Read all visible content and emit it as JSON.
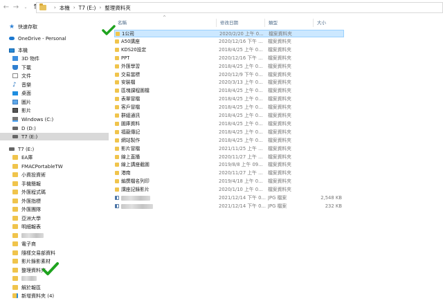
{
  "address": {
    "path": [
      "本機",
      "T7 (E:)",
      "整理資料夾"
    ]
  },
  "sidebar": {
    "items": [
      {
        "label": "快速存取",
        "icon": "star-icon"
      },
      {
        "label": "OneDrive - Personal",
        "icon": "cloud-icon"
      },
      {
        "label": "本機",
        "icon": "computer-icon"
      },
      {
        "label": "3D 物件",
        "icon": "cube-icon"
      },
      {
        "label": "下載",
        "icon": "download-icon"
      },
      {
        "label": "文件",
        "icon": "document-icon"
      },
      {
        "label": "音樂",
        "icon": "music-icon"
      },
      {
        "label": "桌面",
        "icon": "desktop-icon"
      },
      {
        "label": "圖片",
        "icon": "pictures-icon"
      },
      {
        "label": "影片",
        "icon": "video-icon"
      },
      {
        "label": "Windows (C:)",
        "icon": "windows-drive-icon"
      },
      {
        "label": "D (D:)",
        "icon": "drive-icon"
      },
      {
        "label": "T7 (E:)",
        "icon": "drive-icon"
      },
      {
        "label": "T7 (E:)",
        "icon": "drive-icon"
      },
      {
        "label": "EA庫",
        "icon": "folder-icon"
      },
      {
        "label": "FMACPortableTW",
        "icon": "folder-icon"
      },
      {
        "label": "小資投資術",
        "icon": "folder-icon"
      },
      {
        "label": "手機簡報",
        "icon": "folder-icon"
      },
      {
        "label": "外匯程式碼",
        "icon": "folder-icon"
      },
      {
        "label": "外匯指標",
        "icon": "folder-icon"
      },
      {
        "label": "外匯團隊",
        "icon": "folder-icon"
      },
      {
        "label": "亞洲大學",
        "icon": "folder-icon"
      },
      {
        "label": "明細報表",
        "icon": "folder-icon"
      },
      {
        "label": "",
        "icon": "folder-icon"
      },
      {
        "label": "電子商",
        "icon": "folder-icon"
      },
      {
        "label": "隨樣交易部資料",
        "icon": "folder-icon"
      },
      {
        "label": "影片錄影素材",
        "icon": "folder-icon"
      },
      {
        "label": "整理資料夾",
        "icon": "folder-icon"
      },
      {
        "label": "",
        "icon": "folder-icon"
      },
      {
        "label": "解於報區",
        "icon": "folder-icon"
      },
      {
        "label": "新增資料夾 (4)",
        "icon": "new-folder-icon"
      }
    ]
  },
  "columns": {
    "name": "名稱",
    "date": "修改日期",
    "type": "類型",
    "size": "大小"
  },
  "files": [
    {
      "name": "1公司",
      "date": "2020/2/20 上午 0...",
      "type": "檔案資料夾",
      "size": "",
      "kind": "folder"
    },
    {
      "name": "A50講座",
      "date": "2020/12/16 下午 ...",
      "type": "檔案資料夾",
      "size": "",
      "kind": "folder"
    },
    {
      "name": "KDS20設定",
      "date": "2018/4/25 上午 0...",
      "type": "檔案資料夾",
      "size": "",
      "kind": "folder"
    },
    {
      "name": "PPT",
      "date": "2020/12/16 下午 ...",
      "type": "檔案資料夾",
      "size": "",
      "kind": "folder"
    },
    {
      "name": "外匯學習",
      "date": "2018/4/25 上午 0...",
      "type": "檔案資料夾",
      "size": "",
      "kind": "folder"
    },
    {
      "name": "交易當標",
      "date": "2020/12/9 下午 0...",
      "type": "檔案資料夾",
      "size": "",
      "kind": "folder"
    },
    {
      "name": "安裝檔",
      "date": "2020/3/13 上午 0...",
      "type": "檔案資料夾",
      "size": "",
      "kind": "folder"
    },
    {
      "name": "區塊課程圖檔",
      "date": "2018/4/25 上午 0...",
      "type": "檔案資料夾",
      "size": "",
      "kind": "folder"
    },
    {
      "name": "表單冒檔",
      "date": "2018/4/25 上午 0...",
      "type": "檔案資料夾",
      "size": "",
      "kind": "folder"
    },
    {
      "name": "客戶冒檔",
      "date": "2018/4/25 上午 0...",
      "type": "檔案資料夾",
      "size": "",
      "kind": "folder"
    },
    {
      "name": "群組通訊",
      "date": "2018/4/25 上午 0...",
      "type": "檔案資料夾",
      "size": "",
      "kind": "folder"
    },
    {
      "name": "圖庫資料",
      "date": "2018/4/25 上午 0...",
      "type": "檔案資料夾",
      "size": "",
      "kind": "folder"
    },
    {
      "name": "福龍傳記",
      "date": "2018/4/25 上午 0...",
      "type": "檔案資料夾",
      "size": "",
      "kind": "folder"
    },
    {
      "name": "網站製作",
      "date": "2018/4/25 上午 0...",
      "type": "檔案資料夾",
      "size": "",
      "kind": "folder"
    },
    {
      "name": "影片冒檔",
      "date": "2021/11/25 上午 ...",
      "type": "檔案資料夾",
      "size": "",
      "kind": "folder"
    },
    {
      "name": "線上直播",
      "date": "2020/11/27 上午 ...",
      "type": "檔案資料夾",
      "size": "",
      "kind": "folder"
    },
    {
      "name": "線上講座截圖",
      "date": "2019/8/8 上午 09...",
      "type": "檔案資料夾",
      "size": "",
      "kind": "folder"
    },
    {
      "name": "港南",
      "date": "2020/11/27 上午 ...",
      "type": "檔案資料夾",
      "size": "",
      "kind": "folder"
    },
    {
      "name": "編撰檔名列印",
      "date": "2019/4/18 上午 0...",
      "type": "檔案資料夾",
      "size": "",
      "kind": "folder"
    },
    {
      "name": "講座記錄影片",
      "date": "2020/1/10 上午 0...",
      "type": "檔案資料夾",
      "size": "",
      "kind": "folder"
    },
    {
      "name": "",
      "date": "2021/12/14 下午 0...",
      "type": "JPG 檔案",
      "size": "2,548 KB",
      "kind": "jpg"
    },
    {
      "name": "",
      "date": "2021/12/14 下午 0...",
      "type": "JPG 檔案",
      "size": "232 KB",
      "kind": "jpg"
    }
  ],
  "colors": {
    "selection": "#cce8ff",
    "check": "#1fa31f",
    "folder": "#f0c44c"
  }
}
